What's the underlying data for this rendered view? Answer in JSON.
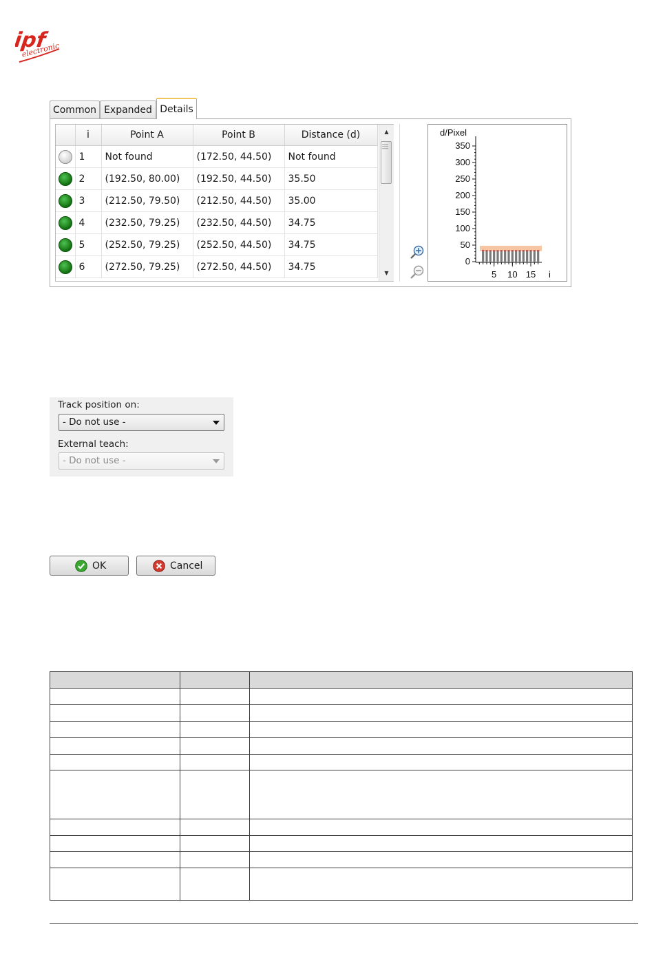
{
  "logo": {
    "top": "ipf",
    "bottom": "electronic"
  },
  "tabs": [
    {
      "label": "Common",
      "active": false
    },
    {
      "label": "Expanded",
      "active": false
    },
    {
      "label": "Details",
      "active": true
    }
  ],
  "grid": {
    "headers": [
      "i",
      "Point A",
      "Point B",
      "Distance (d)"
    ],
    "rows": [
      {
        "status": "gray",
        "i": "1",
        "point_a": "Not found",
        "point_b": "(172.50, 44.50)",
        "distance": "Not found"
      },
      {
        "status": "green",
        "i": "2",
        "point_a": "(192.50, 80.00)",
        "point_b": "(192.50, 44.50)",
        "distance": "35.50"
      },
      {
        "status": "green",
        "i": "3",
        "point_a": "(212.50, 79.50)",
        "point_b": "(212.50, 44.50)",
        "distance": "35.00"
      },
      {
        "status": "green",
        "i": "4",
        "point_a": "(232.50, 79.25)",
        "point_b": "(232.50, 44.50)",
        "distance": "34.75"
      },
      {
        "status": "green",
        "i": "5",
        "point_a": "(252.50, 79.25)",
        "point_b": "(252.50, 44.50)",
        "distance": "34.75"
      },
      {
        "status": "green",
        "i": "6",
        "point_a": "(272.50, 79.25)",
        "point_b": "(272.50, 44.50)",
        "distance": "34.75"
      }
    ]
  },
  "zoom": {
    "in_icon": "zoom-in-icon",
    "out_icon": "zoom-out-icon"
  },
  "chart_data": {
    "type": "bar",
    "ylabel": "d/Pixel",
    "xlabel": "i",
    "ylim": [
      0,
      350
    ],
    "yticks": [
      0,
      50,
      100,
      150,
      200,
      250,
      300,
      350
    ],
    "xticks": [
      5,
      10,
      15
    ],
    "xlim": [
      0,
      18
    ],
    "x": [
      1,
      2,
      3,
      4,
      5,
      6,
      7,
      8,
      9,
      10,
      11,
      12,
      13,
      14,
      15,
      16,
      17
    ],
    "values": [
      0,
      35.5,
      35.0,
      34.75,
      34.75,
      34.75,
      35,
      35,
      35,
      35,
      35,
      35,
      35,
      35,
      35,
      35,
      35
    ],
    "tolerance_band": [
      32,
      48
    ],
    "colors": {
      "bar": "#7a7a7a",
      "bar_top": "#c0504d",
      "band": "#f4b183"
    }
  },
  "track": {
    "position_label": "Track position on:",
    "position_value": "- Do not use -",
    "teach_label": "External teach:",
    "teach_value": "- Do not use -"
  },
  "buttons": {
    "ok": "OK",
    "cancel": "Cancel",
    "ok_icon": "check-icon",
    "cancel_icon": "cancel-x-icon"
  }
}
